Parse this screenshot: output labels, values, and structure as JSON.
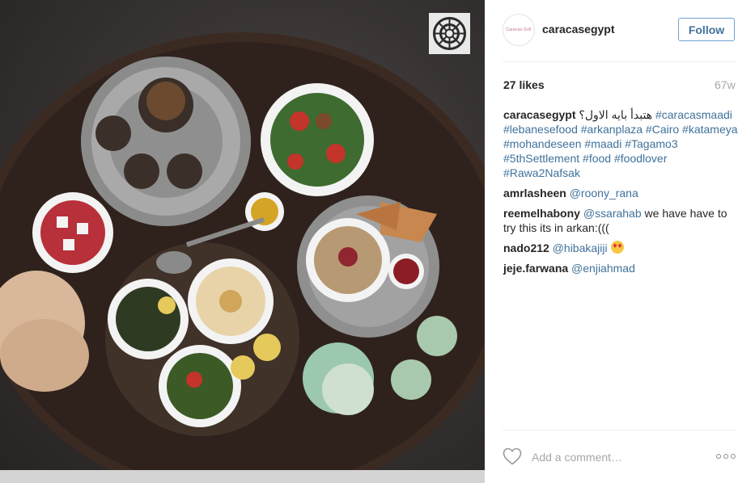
{
  "post": {
    "brand_logo_icon": "arabesque-logo",
    "username": "caracasegypt",
    "avatar_text": "Caracas Grill",
    "follow_label": "Follow",
    "likes": "27 likes",
    "age": "67w",
    "caption": {
      "user": "caracasegypt",
      "text_ar": "هتبدأ بايه الاول؟",
      "tags": "#caracasmaadi #lebanesefood #arkanplaza #Cairo #katameya #mohandeseen #maadi #Tagamo3 #5thSettlement #food #foodlover #Rawa2Nafsak"
    },
    "comments": [
      {
        "user": "amrlasheen",
        "mention": "@roony_rana",
        "text": ""
      },
      {
        "user": "reemelhabony",
        "mention": "@ssarahab",
        "text": "we have have to try this its in arkan:((("
      },
      {
        "user": "nado212",
        "mention": "@hibakajiji",
        "text": "",
        "emoji": "heart-eyes-emoji"
      },
      {
        "user": "jeje.farwana",
        "mention": "@enjiahmad",
        "text": ""
      }
    ],
    "comment_placeholder": "Add a comment…",
    "icons": {
      "like": "heart-icon",
      "more": "more-options-icon"
    },
    "colors": {
      "link": "#3f729b",
      "follow_border": "#70a1d6",
      "muted": "#a5a7aa"
    }
  }
}
